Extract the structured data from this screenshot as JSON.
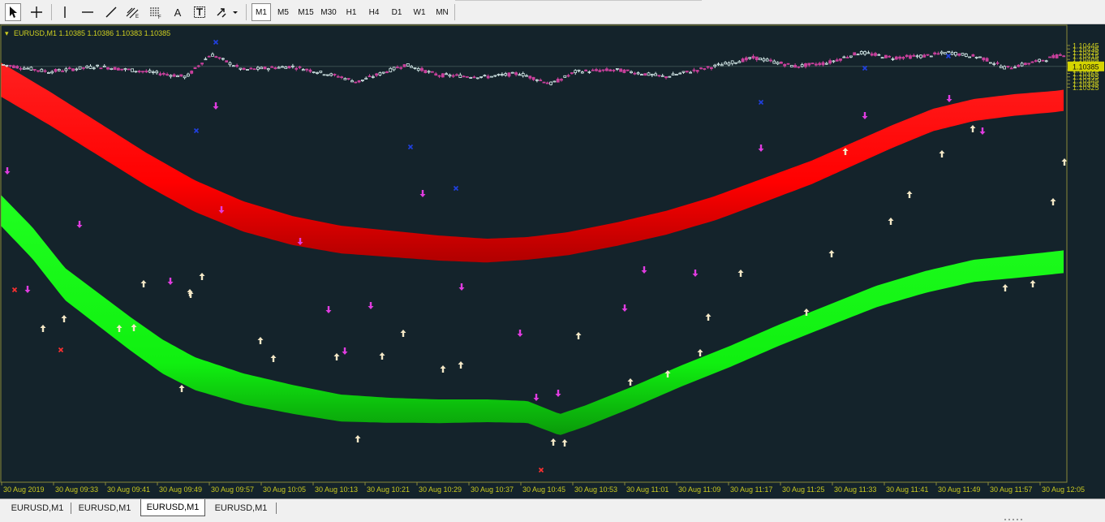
{
  "toolbar": {
    "tools": [
      {
        "name": "cursor-icon"
      },
      {
        "name": "crosshair-icon"
      },
      {
        "name": "vertical-line-icon"
      },
      {
        "name": "horizontal-line-icon"
      },
      {
        "name": "trendline-icon"
      },
      {
        "name": "equidistant-channel-icon"
      },
      {
        "name": "fibonacci-icon"
      },
      {
        "name": "text-label",
        "label": "A"
      },
      {
        "name": "text-box-icon"
      },
      {
        "name": "arrows-menu-icon"
      }
    ],
    "timeframes": [
      "M1",
      "M5",
      "M15",
      "M30",
      "H1",
      "H4",
      "D1",
      "W1",
      "MN"
    ],
    "active_timeframe": "M1"
  },
  "chart": {
    "header": "EURUSD,M1  1.10385 1.10386 1.10383 1.10385",
    "current_price": "1.10385",
    "price_labels": [
      "1.10445",
      "1.10435",
      "1.10425",
      "1.10415",
      "1.10405",
      "1.10395",
      "1.10375",
      "1.10365",
      "1.10355",
      "1.10345",
      "1.10335",
      "1.10325"
    ],
    "time_labels": [
      "30 Aug 2019",
      "30 Aug 09:33",
      "30 Aug 09:41",
      "30 Aug 09:49",
      "30 Aug 09:57",
      "30 Aug 10:05",
      "30 Aug 10:13",
      "30 Aug 10:21",
      "30 Aug 10:29",
      "30 Aug 10:37",
      "30 Aug 10:45",
      "30 Aug 10:53",
      "30 Aug 11:01",
      "30 Aug 11:09",
      "30 Aug 11:17",
      "30 Aug 11:25",
      "30 Aug 11:33",
      "30 Aug 11:41",
      "30 Aug 11:49",
      "30 Aug 11:57",
      "30 Aug 12:05"
    ],
    "colors": {
      "background": "#14232b",
      "bull_candle": "#d8ecec",
      "bear_candle": "#c8409c",
      "upper_band": "#ff1010",
      "lower_band": "#12ff12",
      "axis": "#8a8a3a",
      "text": "#c8c820",
      "buy_arrow": "#f3e7c6",
      "sell_arrow": "#e03ce0",
      "blue_marker": "#2040e0",
      "red_marker": "#ff3030"
    }
  },
  "tabs": {
    "items": [
      "EURUSD,M1",
      "EURUSD,M1",
      "EURUSD,M1",
      "EURUSD,M1"
    ],
    "active_index": 2
  }
}
